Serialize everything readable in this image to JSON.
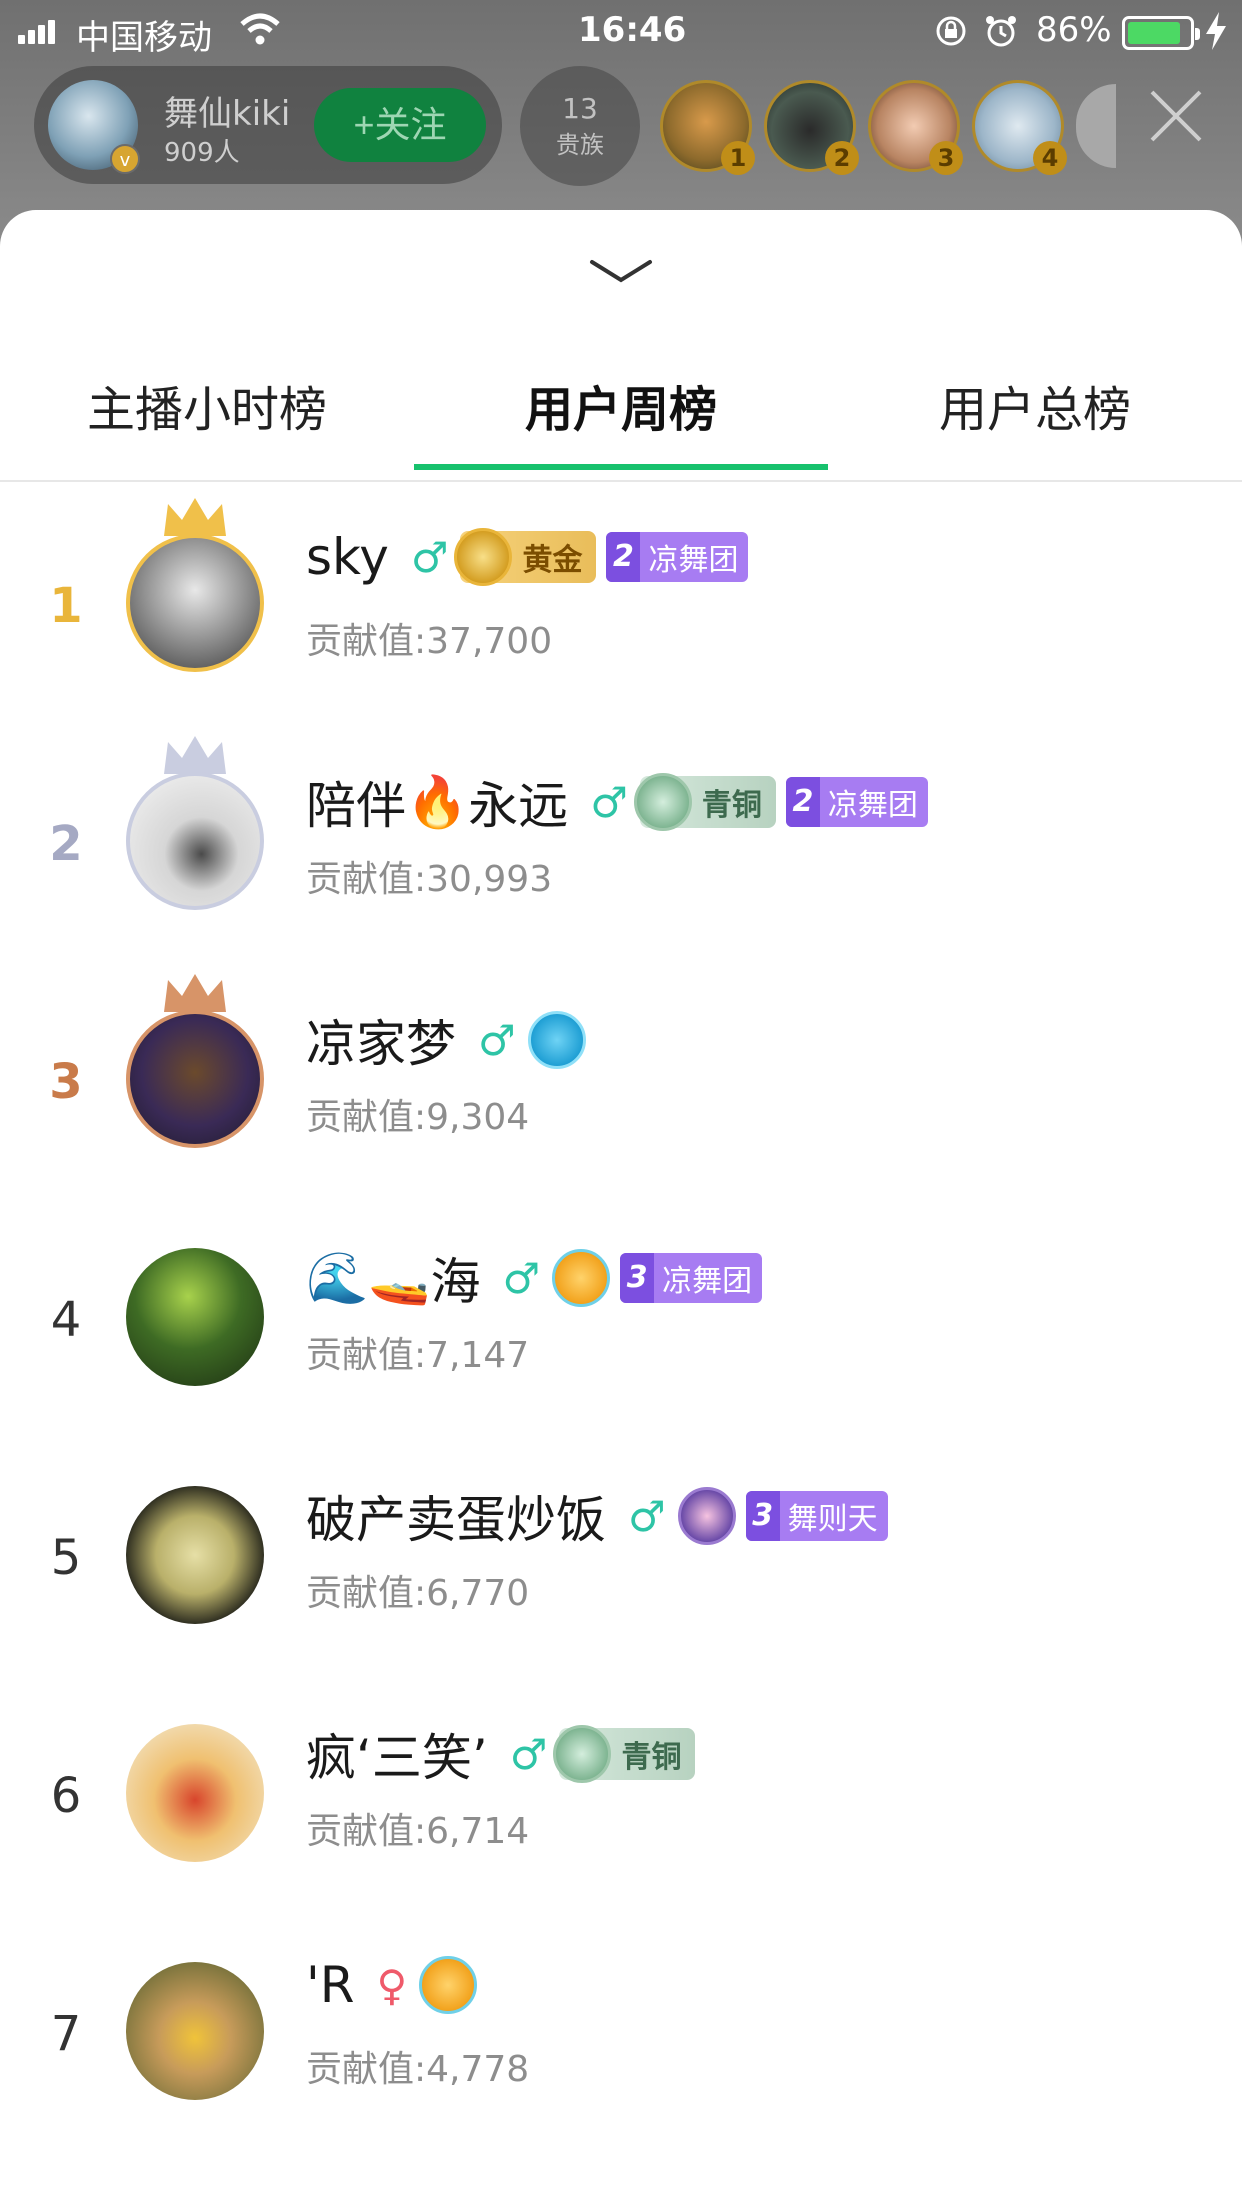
{
  "status_bar": {
    "carrier": "中国移动",
    "time": "16:46",
    "battery_percent": "86%",
    "battery_level": 0.86
  },
  "host": {
    "name": "舞仙kiki",
    "audience": "909人",
    "follow_label": "+关注",
    "noble_count": "13",
    "noble_label": "贵族"
  },
  "top_viewers": [
    {
      "rank": "1"
    },
    {
      "rank": "2"
    },
    {
      "rank": "3"
    },
    {
      "rank": "4"
    }
  ],
  "tabs": [
    {
      "label": "主播小时榜",
      "active": false
    },
    {
      "label": "用户周榜",
      "active": true
    },
    {
      "label": "用户总榜",
      "active": false
    }
  ],
  "ranking": [
    {
      "rank": "1",
      "name": "sky",
      "gender": "male",
      "level_label": "黄金",
      "fan_num": "2",
      "fan_club": "凉舞团",
      "contribution": "贡献值:37,700"
    },
    {
      "rank": "2",
      "name_before": "陪伴",
      "name_emoji": "🔥",
      "name_after": "永远",
      "gender": "male",
      "level_label": "青铜",
      "fan_num": "2",
      "fan_club": "凉舞团",
      "contribution": "贡献值:30,993"
    },
    {
      "rank": "3",
      "name": "凉家梦",
      "gender": "male",
      "contribution": "贡献值:9,304"
    },
    {
      "rank": "4",
      "name_emoji": "🌊🚤",
      "name": "海",
      "gender": "male",
      "fan_num": "3",
      "fan_club": "凉舞团",
      "contribution": "贡献值:7,147"
    },
    {
      "rank": "5",
      "name": "破产卖蛋炒饭",
      "gender": "male",
      "fan_num": "3",
      "fan_club": "舞则天",
      "contribution": "贡献值:6,770"
    },
    {
      "rank": "6",
      "name": "疯‘三笑’",
      "gender": "male",
      "level_label": "青铜",
      "contribution": "贡献值:6,714"
    },
    {
      "rank": "7",
      "name": "'R",
      "gender": "female",
      "contribution": "贡献值:4,778"
    }
  ],
  "colors": {
    "accent": "#17c16d",
    "rank_gold": "#e9b53a",
    "rank_silver": "#a5a9c3",
    "rank_bronze": "#c97b4a",
    "male": "#2ec4a6",
    "fan_badge": "#a77cf2"
  },
  "icons": {
    "collapse": "chevron-down-icon",
    "close": "close-icon",
    "male": "male-symbol-icon",
    "female": "female-symbol-icon",
    "crown": "crown-icon"
  }
}
